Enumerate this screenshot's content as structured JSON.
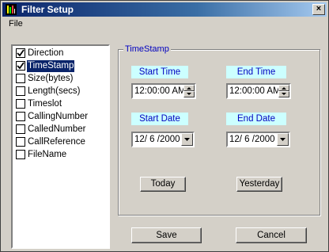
{
  "window": {
    "title": "Filter Setup",
    "close_label": "×"
  },
  "menubar": {
    "items": [
      {
        "label": "File"
      }
    ]
  },
  "fields": {
    "items": [
      {
        "label": "Direction",
        "checked": true
      },
      {
        "label": "TimeStamp",
        "checked": true,
        "selected": true
      },
      {
        "label": "Size(bytes)",
        "checked": false
      },
      {
        "label": "Length(secs)",
        "checked": false
      },
      {
        "label": "Timeslot",
        "checked": false
      },
      {
        "label": "CallingNumber",
        "checked": false
      },
      {
        "label": "CalledNumber",
        "checked": false
      },
      {
        "label": "CallReference",
        "checked": false
      },
      {
        "label": "FileName",
        "checked": false
      }
    ]
  },
  "timestamp": {
    "group_title": "TimeStamp",
    "start_time_label": "Start Time",
    "end_time_label": "End Time",
    "start_time_value": "12:00:00 AM",
    "end_time_value": "12:00:00 AM",
    "start_date_label": "Start Date",
    "end_date_label": "End Date",
    "start_date_value": "12/ 6 /2000",
    "end_date_value": "12/ 6 /2000",
    "today_label": "Today",
    "yesterday_label": "Yesterday"
  },
  "footer": {
    "save_label": "Save",
    "cancel_label": "Cancel"
  },
  "colors": {
    "title_start": "#0a246a",
    "title_end": "#a6caf0",
    "label_bg": "#ccffff",
    "label_fg": "#0000c0",
    "selection": "#0a246a"
  }
}
